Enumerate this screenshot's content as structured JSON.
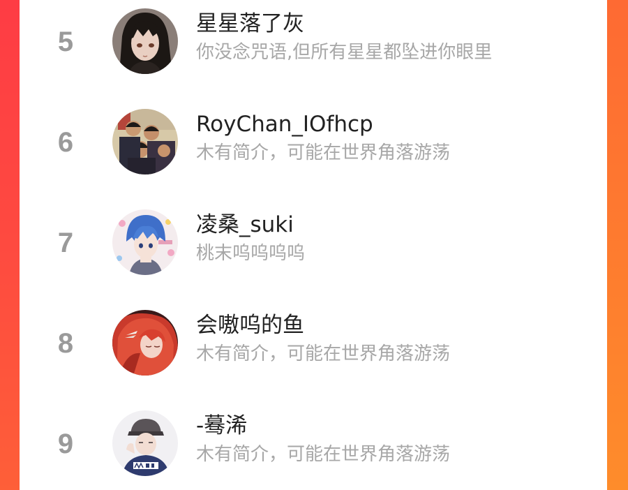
{
  "colors": {
    "accent_left": "#fe3f41",
    "accent_right": "#fe8a2c",
    "card": "#ffffff",
    "rank": "#9a9a9a",
    "name": "#222222",
    "bio": "#a7a7a7"
  },
  "ranking": {
    "rows": [
      {
        "rank": "5",
        "name": "星星落了灰",
        "bio": "你没念咒语,但所有星星都坠进你眼里",
        "avatar": "avatar-dark-hair-girl"
      },
      {
        "rank": "6",
        "name": "RoyChan_IOfhcp",
        "bio": "木有简介，可能在世界角落游荡",
        "avatar": "avatar-group-photo"
      },
      {
        "rank": "7",
        "name": "凌桑_suki",
        "bio": "桃末呜呜呜呜",
        "avatar": "avatar-blue-hair-anime"
      },
      {
        "rank": "8",
        "name": "会嗷呜的鱼",
        "bio": "木有简介，可能在世界角落游荡",
        "avatar": "avatar-red-hair-girl"
      },
      {
        "rank": "9",
        "name": "-蓦浠",
        "bio": "木有简介，可能在世界角落游荡",
        "avatar": "avatar-cap-boy-merci"
      }
    ]
  }
}
